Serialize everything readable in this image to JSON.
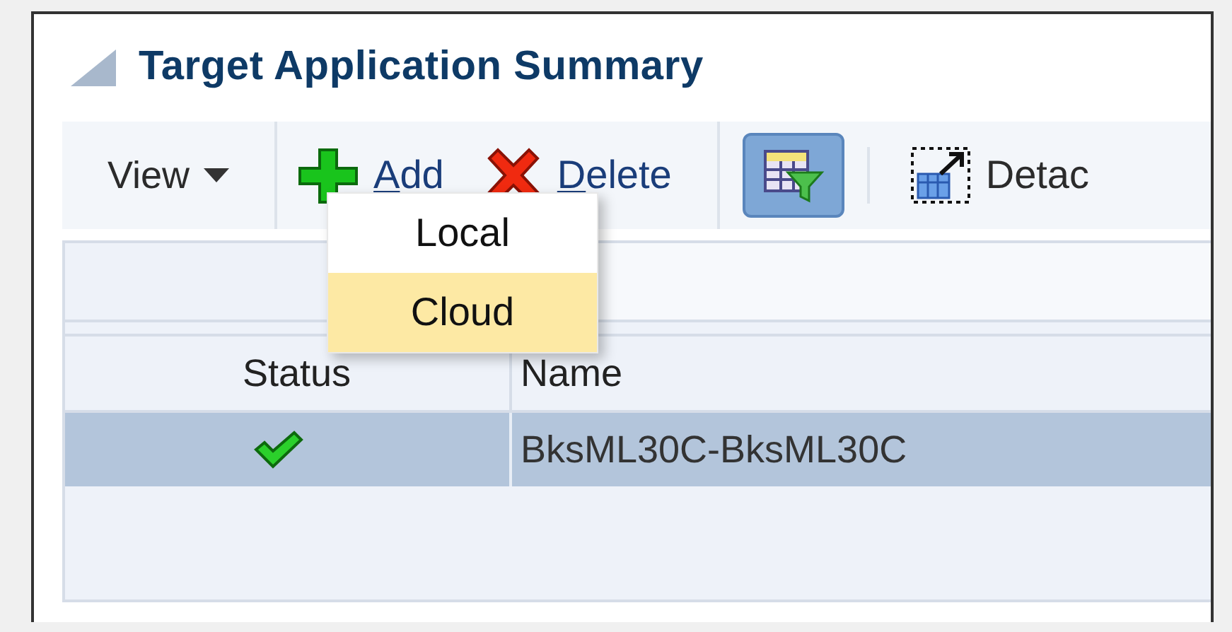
{
  "panel": {
    "title": "Target Application Summary",
    "expanded": true
  },
  "toolbar": {
    "items": [
      {
        "kind": "menu",
        "label": "View"
      },
      {
        "kind": "add",
        "label": "Add",
        "mnemonic": true
      },
      {
        "kind": "delete",
        "label": "Delete",
        "mnemonic": true
      },
      {
        "kind": "filter",
        "selected": true
      },
      {
        "kind": "detach",
        "label": "Detac",
        "mnemonic": false
      }
    ]
  },
  "add_menu": {
    "items": [
      {
        "label": "Local",
        "selected": false
      },
      {
        "label": "Cloud",
        "selected": true
      }
    ]
  },
  "table": {
    "columns": [
      {
        "label": "Status"
      },
      {
        "label": "Name"
      }
    ],
    "rows": [
      {
        "name": "BksML30C-BksML30C",
        "selected": true
      }
    ]
  }
}
